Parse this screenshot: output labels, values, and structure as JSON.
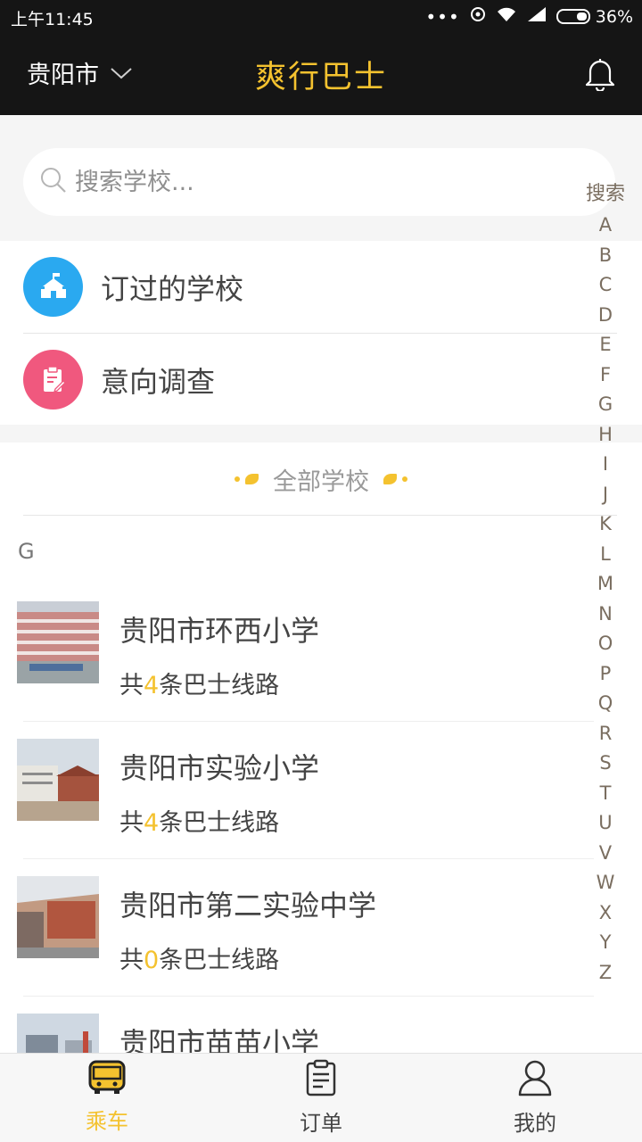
{
  "status_bar": {
    "time": "上午11:45",
    "battery": "36%",
    "battery_level": 0.36
  },
  "header": {
    "city": "贵阳市",
    "title": "爽行巴士"
  },
  "search": {
    "placeholder": "搜索学校..."
  },
  "quick_items": [
    {
      "label": "订过的学校",
      "icon": "school-building-icon",
      "color": "#2aa9f0"
    },
    {
      "label": "意向调查",
      "icon": "clipboard-edit-icon",
      "color": "#f0587e"
    }
  ],
  "all_schools_label": "全部学校",
  "section_letter": "G",
  "schools": [
    {
      "name": "贵阳市环西小学",
      "routes_prefix": "共",
      "route_count": "4",
      "routes_suffix": "条巴士线路"
    },
    {
      "name": "贵阳市实验小学",
      "routes_prefix": "共",
      "route_count": "4",
      "routes_suffix": "条巴士线路"
    },
    {
      "name": "贵阳市第二实验中学",
      "routes_prefix": "共",
      "route_count": "0",
      "routes_suffix": "条巴士线路"
    },
    {
      "name": "贵阳市苗苗小学"
    }
  ],
  "index": {
    "search_label": "搜索",
    "letters": [
      "A",
      "B",
      "C",
      "D",
      "E",
      "F",
      "G",
      "H",
      "I",
      "J",
      "K",
      "L",
      "M",
      "N",
      "O",
      "P",
      "Q",
      "R",
      "S",
      "T",
      "U",
      "V",
      "W",
      "X",
      "Y",
      "Z"
    ]
  },
  "tabs": [
    {
      "label": "乘车",
      "icon": "bus-icon",
      "active": true
    },
    {
      "label": "订单",
      "icon": "clipboard-icon",
      "active": false
    },
    {
      "label": "我的",
      "icon": "user-icon",
      "active": false
    }
  ],
  "colors": {
    "accent": "#f4c22f",
    "header_bg": "#151515",
    "blue": "#2aa9f0",
    "pink": "#f0587e"
  }
}
